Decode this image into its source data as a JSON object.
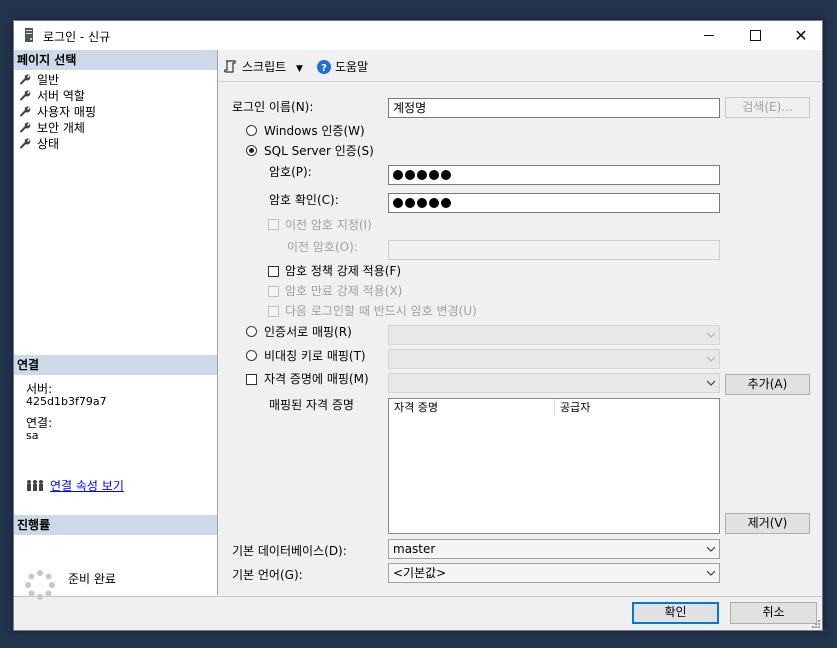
{
  "window": {
    "title": "로그인 - 신규",
    "minimize_label": "",
    "close_symbol": "✕"
  },
  "left": {
    "page_select_header": "페이지 선택",
    "pages": [
      {
        "label": "일반"
      },
      {
        "label": "서버 역할"
      },
      {
        "label": "사용자 매핑"
      },
      {
        "label": "보안 개체"
      },
      {
        "label": "상태"
      }
    ],
    "connection_header": "연결",
    "server_label": "서버:",
    "server_value": "425d1b3f79a7",
    "connection_label": "연결:",
    "connection_value": "sa",
    "view_connection_link": "연결 속성 보기",
    "progress_header": "진행률",
    "progress_status": "준비 완료"
  },
  "toolbar": {
    "script_label": "스크립트",
    "help_label": "도움말"
  },
  "form": {
    "login_name_label": "로그인 이름(N):",
    "login_name_value": "계정명",
    "search_button": "검색(E)...",
    "windows_auth_label": "Windows 인증(W)",
    "sql_auth_label": "SQL Server 인증(S)",
    "password_label": "암호(P):",
    "confirm_password_label": "암호 확인(C):",
    "password_dots": 5,
    "old_password_check_label": "이전 암호 지정(I)",
    "old_password_label": "이전 암호(O):",
    "enforce_policy_label": "암호 정책 강제 적용(F)",
    "enforce_expiration_label": "암호 만료 강제 적용(X)",
    "must_change_label": "다음 로그인할 때 반드시 암호 변경(U)",
    "cert_mapped_label": "인증서로 매핑(R)",
    "asym_key_label": "비대칭 키로 매핑(T)",
    "credential_map_label": "자격 증명에 매핑(M)",
    "add_button": "추가(A)",
    "mapped_credentials_label": "매핑된 자격 증명",
    "credentials_columns": [
      "자격 증명",
      "공급자"
    ],
    "remove_button": "제거(V)",
    "default_db_label": "기본 데이터베이스(D):",
    "default_db_value": "master",
    "default_lang_label": "기본 언어(G):",
    "default_lang_value": "<기본값>"
  },
  "footer": {
    "ok_button": "확인",
    "cancel_button": "취소"
  },
  "colors": {
    "section_header_bg": "#ccd9e8",
    "link": "#0000ff",
    "primary_border": "#0078d7",
    "help_icon": "#1e6fd9"
  }
}
